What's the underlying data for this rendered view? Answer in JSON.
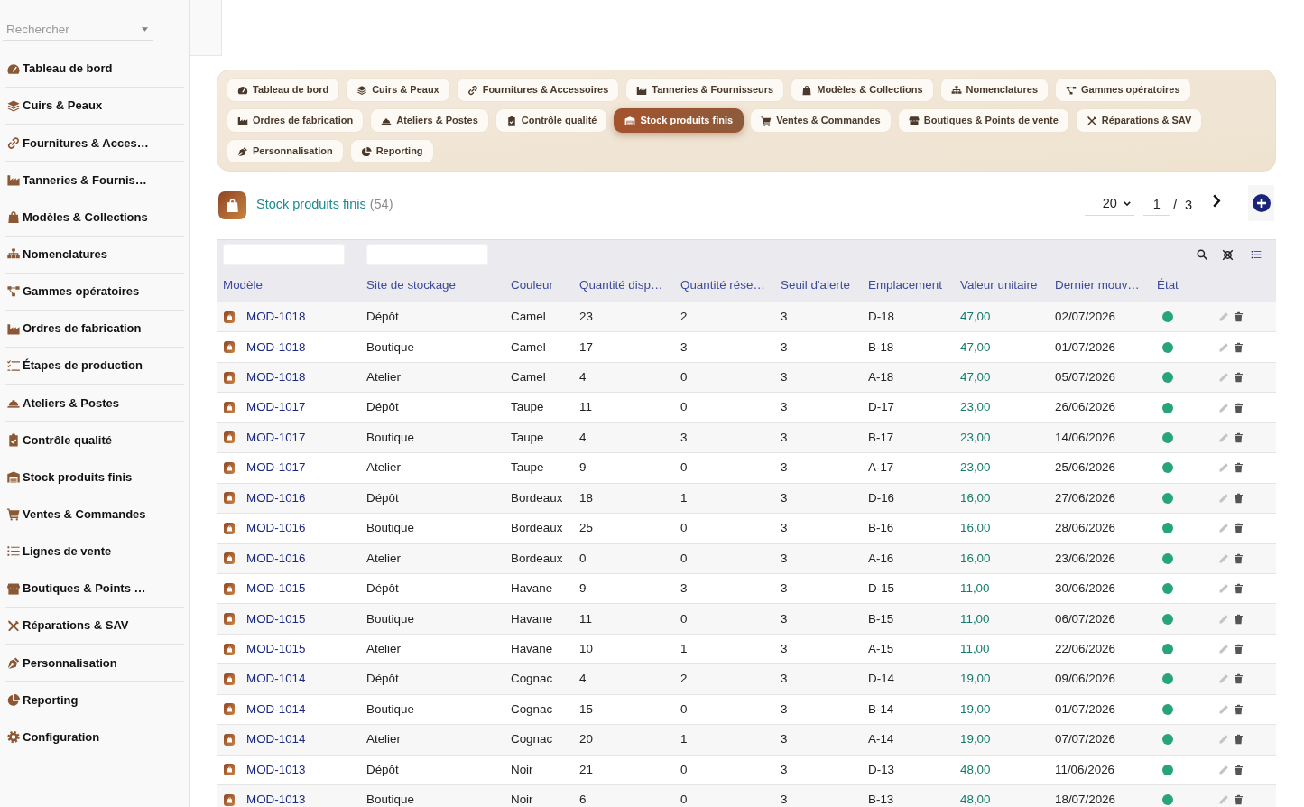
{
  "sidebar": {
    "search": {
      "placeholder": "Rechercher"
    },
    "items": [
      {
        "label": "Tableau de bord"
      },
      {
        "label": "Cuirs & Peaux"
      },
      {
        "label": "Fournitures & Acces…"
      },
      {
        "label": "Tanneries & Fournis…"
      },
      {
        "label": "Modèles & Collections"
      },
      {
        "label": "Nomenclatures"
      },
      {
        "label": "Gammes opératoires"
      },
      {
        "label": "Ordres de fabrication"
      },
      {
        "label": "Étapes de production"
      },
      {
        "label": "Ateliers & Postes"
      },
      {
        "label": "Contrôle qualité"
      },
      {
        "label": "Stock produits finis"
      },
      {
        "label": "Ventes & Commandes"
      },
      {
        "label": "Lignes de vente"
      },
      {
        "label": "Boutiques & Points …"
      },
      {
        "label": "Réparations & SAV"
      },
      {
        "label": "Personnalisation"
      },
      {
        "label": "Reporting"
      },
      {
        "label": "Configuration"
      }
    ]
  },
  "tabs": [
    {
      "label": "Tableau de bord",
      "selected": false
    },
    {
      "label": "Cuirs & Peaux",
      "selected": false
    },
    {
      "label": "Fournitures & Accessoires",
      "selected": false
    },
    {
      "label": "Tanneries & Fournisseurs",
      "selected": false
    },
    {
      "label": "Modèles & Collections",
      "selected": false
    },
    {
      "label": "Nomenclatures",
      "selected": false
    },
    {
      "label": "Gammes opératoires",
      "selected": false
    },
    {
      "label": "Ordres de fabrication",
      "selected": false
    },
    {
      "label": "Ateliers & Postes",
      "selected": false
    },
    {
      "label": "Contrôle qualité",
      "selected": false
    },
    {
      "label": "Stock produits finis",
      "selected": true
    },
    {
      "label": "Ventes & Commandes",
      "selected": false
    },
    {
      "label": "Boutiques & Points de vente",
      "selected": false
    },
    {
      "label": "Réparations & SAV",
      "selected": false
    },
    {
      "label": "Personnalisation",
      "selected": false
    },
    {
      "label": "Reporting",
      "selected": false
    }
  ],
  "header": {
    "title": "Stock produits finis",
    "count": "(54)"
  },
  "pagination": {
    "page_size": "20",
    "page": "1",
    "separator": "/",
    "page_count": "3"
  },
  "table": {
    "columns": [
      {
        "label": "Modèle",
        "filterable": true
      },
      {
        "label": "Site de stockage",
        "filterable": true
      },
      {
        "label": "Couleur",
        "filterable": false
      },
      {
        "label": "Quantité disp…",
        "filterable": false
      },
      {
        "label": "Quantité rése…",
        "filterable": false
      },
      {
        "label": "Seuil d'alerte",
        "filterable": false
      },
      {
        "label": "Emplacement",
        "filterable": false
      },
      {
        "label": "Valeur unitaire",
        "filterable": false
      },
      {
        "label": "Dernier mouv…",
        "filterable": false
      },
      {
        "label": "État",
        "filterable": false
      }
    ],
    "rows": [
      {
        "cells": [
          "MOD-1018",
          "Dépôt",
          "Camel",
          "23",
          "2",
          "3",
          "D-18",
          "47,00",
          "02/07/2026"
        ],
        "color": "#27a47b"
      },
      {
        "cells": [
          "MOD-1018",
          "Boutique",
          "Camel",
          "17",
          "3",
          "3",
          "B-18",
          "47,00",
          "01/07/2026"
        ],
        "color": "#27a47b"
      },
      {
        "cells": [
          "MOD-1018",
          "Atelier",
          "Camel",
          "4",
          "0",
          "3",
          "A-18",
          "47,00",
          "05/07/2026"
        ],
        "color": "#27a47b"
      },
      {
        "cells": [
          "MOD-1017",
          "Dépôt",
          "Taupe",
          "11",
          "0",
          "3",
          "D-17",
          "23,00",
          "26/06/2026"
        ],
        "color": "#27a47b"
      },
      {
        "cells": [
          "MOD-1017",
          "Boutique",
          "Taupe",
          "4",
          "3",
          "3",
          "B-17",
          "23,00",
          "14/06/2026"
        ],
        "color": "#27a47b"
      },
      {
        "cells": [
          "MOD-1017",
          "Atelier",
          "Taupe",
          "9",
          "0",
          "3",
          "A-17",
          "23,00",
          "25/06/2026"
        ],
        "color": "#27a47b"
      },
      {
        "cells": [
          "MOD-1016",
          "Dépôt",
          "Bordeaux",
          "18",
          "1",
          "3",
          "D-16",
          "16,00",
          "27/06/2026"
        ],
        "color": "#27a47b"
      },
      {
        "cells": [
          "MOD-1016",
          "Boutique",
          "Bordeaux",
          "25",
          "0",
          "3",
          "B-16",
          "16,00",
          "28/06/2026"
        ],
        "color": "#27a47b"
      },
      {
        "cells": [
          "MOD-1016",
          "Atelier",
          "Bordeaux",
          "0",
          "0",
          "3",
          "A-16",
          "16,00",
          "23/06/2026"
        ],
        "color": "#27a47b"
      },
      {
        "cells": [
          "MOD-1015",
          "Dépôt",
          "Havane",
          "9",
          "3",
          "3",
          "D-15",
          "11,00",
          "30/06/2026"
        ],
        "color": "#27a47b"
      },
      {
        "cells": [
          "MOD-1015",
          "Boutique",
          "Havane",
          "11",
          "0",
          "3",
          "B-15",
          "11,00",
          "06/07/2026"
        ],
        "color": "#27a47b"
      },
      {
        "cells": [
          "MOD-1015",
          "Atelier",
          "Havane",
          "10",
          "1",
          "3",
          "A-15",
          "11,00",
          "22/06/2026"
        ],
        "color": "#27a47b"
      },
      {
        "cells": [
          "MOD-1014",
          "Dépôt",
          "Cognac",
          "4",
          "2",
          "3",
          "D-14",
          "19,00",
          "09/06/2026"
        ],
        "color": "#27a47b"
      },
      {
        "cells": [
          "MOD-1014",
          "Boutique",
          "Cognac",
          "15",
          "0",
          "3",
          "B-14",
          "19,00",
          "01/07/2026"
        ],
        "color": "#27a47b"
      },
      {
        "cells": [
          "MOD-1014",
          "Atelier",
          "Cognac",
          "20",
          "1",
          "3",
          "A-14",
          "19,00",
          "07/07/2026"
        ],
        "color": "#27a47b"
      },
      {
        "cells": [
          "MOD-1013",
          "Dépôt",
          "Noir",
          "21",
          "0",
          "3",
          "D-13",
          "48,00",
          "11/06/2026"
        ],
        "color": "#27a47b"
      },
      {
        "cells": [
          "MOD-1013",
          "Boutique",
          "Noir",
          "6",
          "0",
          "3",
          "B-13",
          "48,00",
          "18/07/2026"
        ],
        "color": "#27a47b"
      }
    ]
  }
}
